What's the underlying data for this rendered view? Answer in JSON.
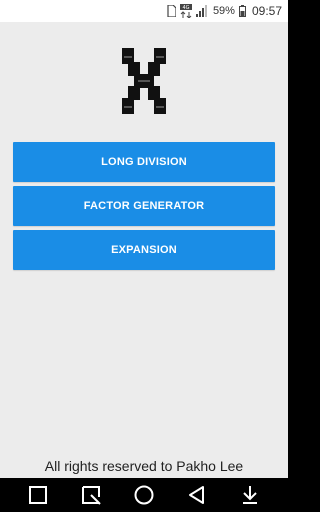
{
  "status_bar": {
    "network": "4G",
    "battery": "59%",
    "time": "09:57",
    "icons": [
      "sim-icon",
      "network-4g-icon",
      "signal-icon",
      "battery-icon"
    ]
  },
  "logo": {
    "icon": "app-x-logo-icon"
  },
  "menu": {
    "items": [
      {
        "label": "LONG DIVISION"
      },
      {
        "label": "FACTOR GENERATOR"
      },
      {
        "label": "EXPANSION"
      }
    ]
  },
  "footer": {
    "text": "All rights reserved to Pakho Lee"
  },
  "nav_bar": {
    "icons": [
      "square-icon",
      "quick-note-icon",
      "home-circle-icon",
      "back-triangle-icon",
      "download-icon"
    ]
  },
  "colors": {
    "accent": "#1a8de6",
    "background": "#ececec",
    "nav_bar": "#000000"
  }
}
